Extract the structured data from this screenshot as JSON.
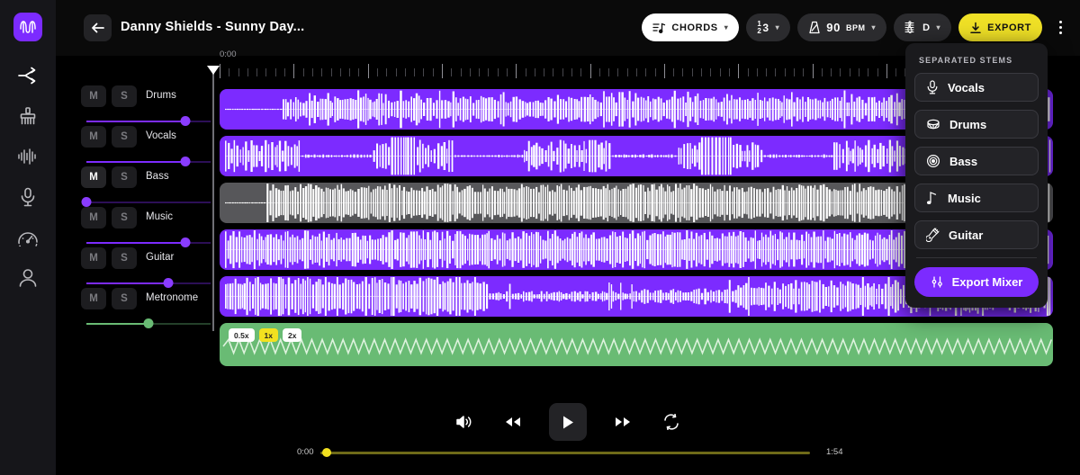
{
  "app": {
    "logo_icon": "waveform-logo-icon",
    "accent_purple": "#7C2BFF",
    "accent_yellow": "#EFE026",
    "accent_green": "#69BB74",
    "muted_gray": "#57575A"
  },
  "rail": {
    "items": [
      {
        "icon": "split-stems-icon",
        "name": "sidebar-item-split"
      },
      {
        "icon": "cleanup-brush-icon",
        "name": "sidebar-item-cleanup"
      },
      {
        "icon": "equalizer-icon",
        "name": "sidebar-item-equalizer"
      },
      {
        "icon": "microphone-icon",
        "name": "sidebar-item-vocals"
      },
      {
        "icon": "speedometer-icon",
        "name": "sidebar-item-tempo"
      },
      {
        "icon": "person-icon",
        "name": "sidebar-item-account"
      }
    ]
  },
  "header": {
    "back_icon": "arrow-left-icon",
    "title": "Danny Shields - Sunny Day...",
    "toolbar": {
      "chords_label": "CHORDS",
      "chords_icon": "chords-note-icon",
      "time_signature": "1 2 3",
      "time_sig_top": "1",
      "time_sig_bottom": "2",
      "time_sig_beats": "3",
      "bpm_value": "90",
      "bpm_unit": "BPM",
      "bpm_icon": "metronome-icon",
      "key_value": "D",
      "key_icon": "treble-clef-icon",
      "export_label": "EXPORT",
      "export_icon": "download-icon",
      "kebab_icon": "more-vertical-icon"
    }
  },
  "mixer": {
    "mute_label": "M",
    "solo_label": "S",
    "tracks": [
      {
        "name": "Drums",
        "mute_on": false,
        "solo_on": false,
        "volume": 80,
        "color": "purple"
      },
      {
        "name": "Vocals",
        "mute_on": false,
        "solo_on": false,
        "volume": 80,
        "color": "purple"
      },
      {
        "name": "Bass",
        "mute_on": true,
        "solo_on": false,
        "volume": 0,
        "color": "purple"
      },
      {
        "name": "Music",
        "mute_on": false,
        "solo_on": false,
        "volume": 80,
        "color": "purple"
      },
      {
        "name": "Guitar",
        "mute_on": false,
        "solo_on": false,
        "volume": 66,
        "color": "purple"
      },
      {
        "name": "Metronome",
        "mute_on": false,
        "solo_on": false,
        "volume": 50,
        "color": "green"
      }
    ]
  },
  "timeline": {
    "start_time": "0:00",
    "end_time": "1:54",
    "playhead_position": "0:00",
    "speed_options": [
      {
        "label": "0.5x",
        "selected": false
      },
      {
        "label": "1x",
        "selected": true
      },
      {
        "label": "2x",
        "selected": false
      }
    ],
    "waveform_tracks": [
      {
        "name": "Drums",
        "state": "active"
      },
      {
        "name": "Vocals",
        "state": "active"
      },
      {
        "name": "Bass",
        "state": "muted"
      },
      {
        "name": "Music",
        "state": "active"
      },
      {
        "name": "Guitar",
        "state": "active"
      },
      {
        "name": "Metronome",
        "state": "metronome"
      }
    ]
  },
  "stems_menu": {
    "title": "SEPARATED STEMS",
    "items": [
      {
        "label": "Vocals",
        "icon": "microphone-icon"
      },
      {
        "label": "Drums",
        "icon": "drum-icon"
      },
      {
        "label": "Bass",
        "icon": "bass-target-icon"
      },
      {
        "label": "Music",
        "icon": "music-note-icon"
      },
      {
        "label": "Guitar",
        "icon": "guitar-icon"
      }
    ],
    "export_mixer_label": "Export Mixer",
    "export_mixer_icon": "sliders-icon"
  },
  "transport": {
    "volume_icon": "volume-icon",
    "rewind_icon": "rewind-icon",
    "play_icon": "play-icon",
    "forward_icon": "fast-forward-icon",
    "loop_icon": "loop-icon",
    "current_time": "0:00",
    "total_time": "1:54",
    "progress_percent": 0
  }
}
